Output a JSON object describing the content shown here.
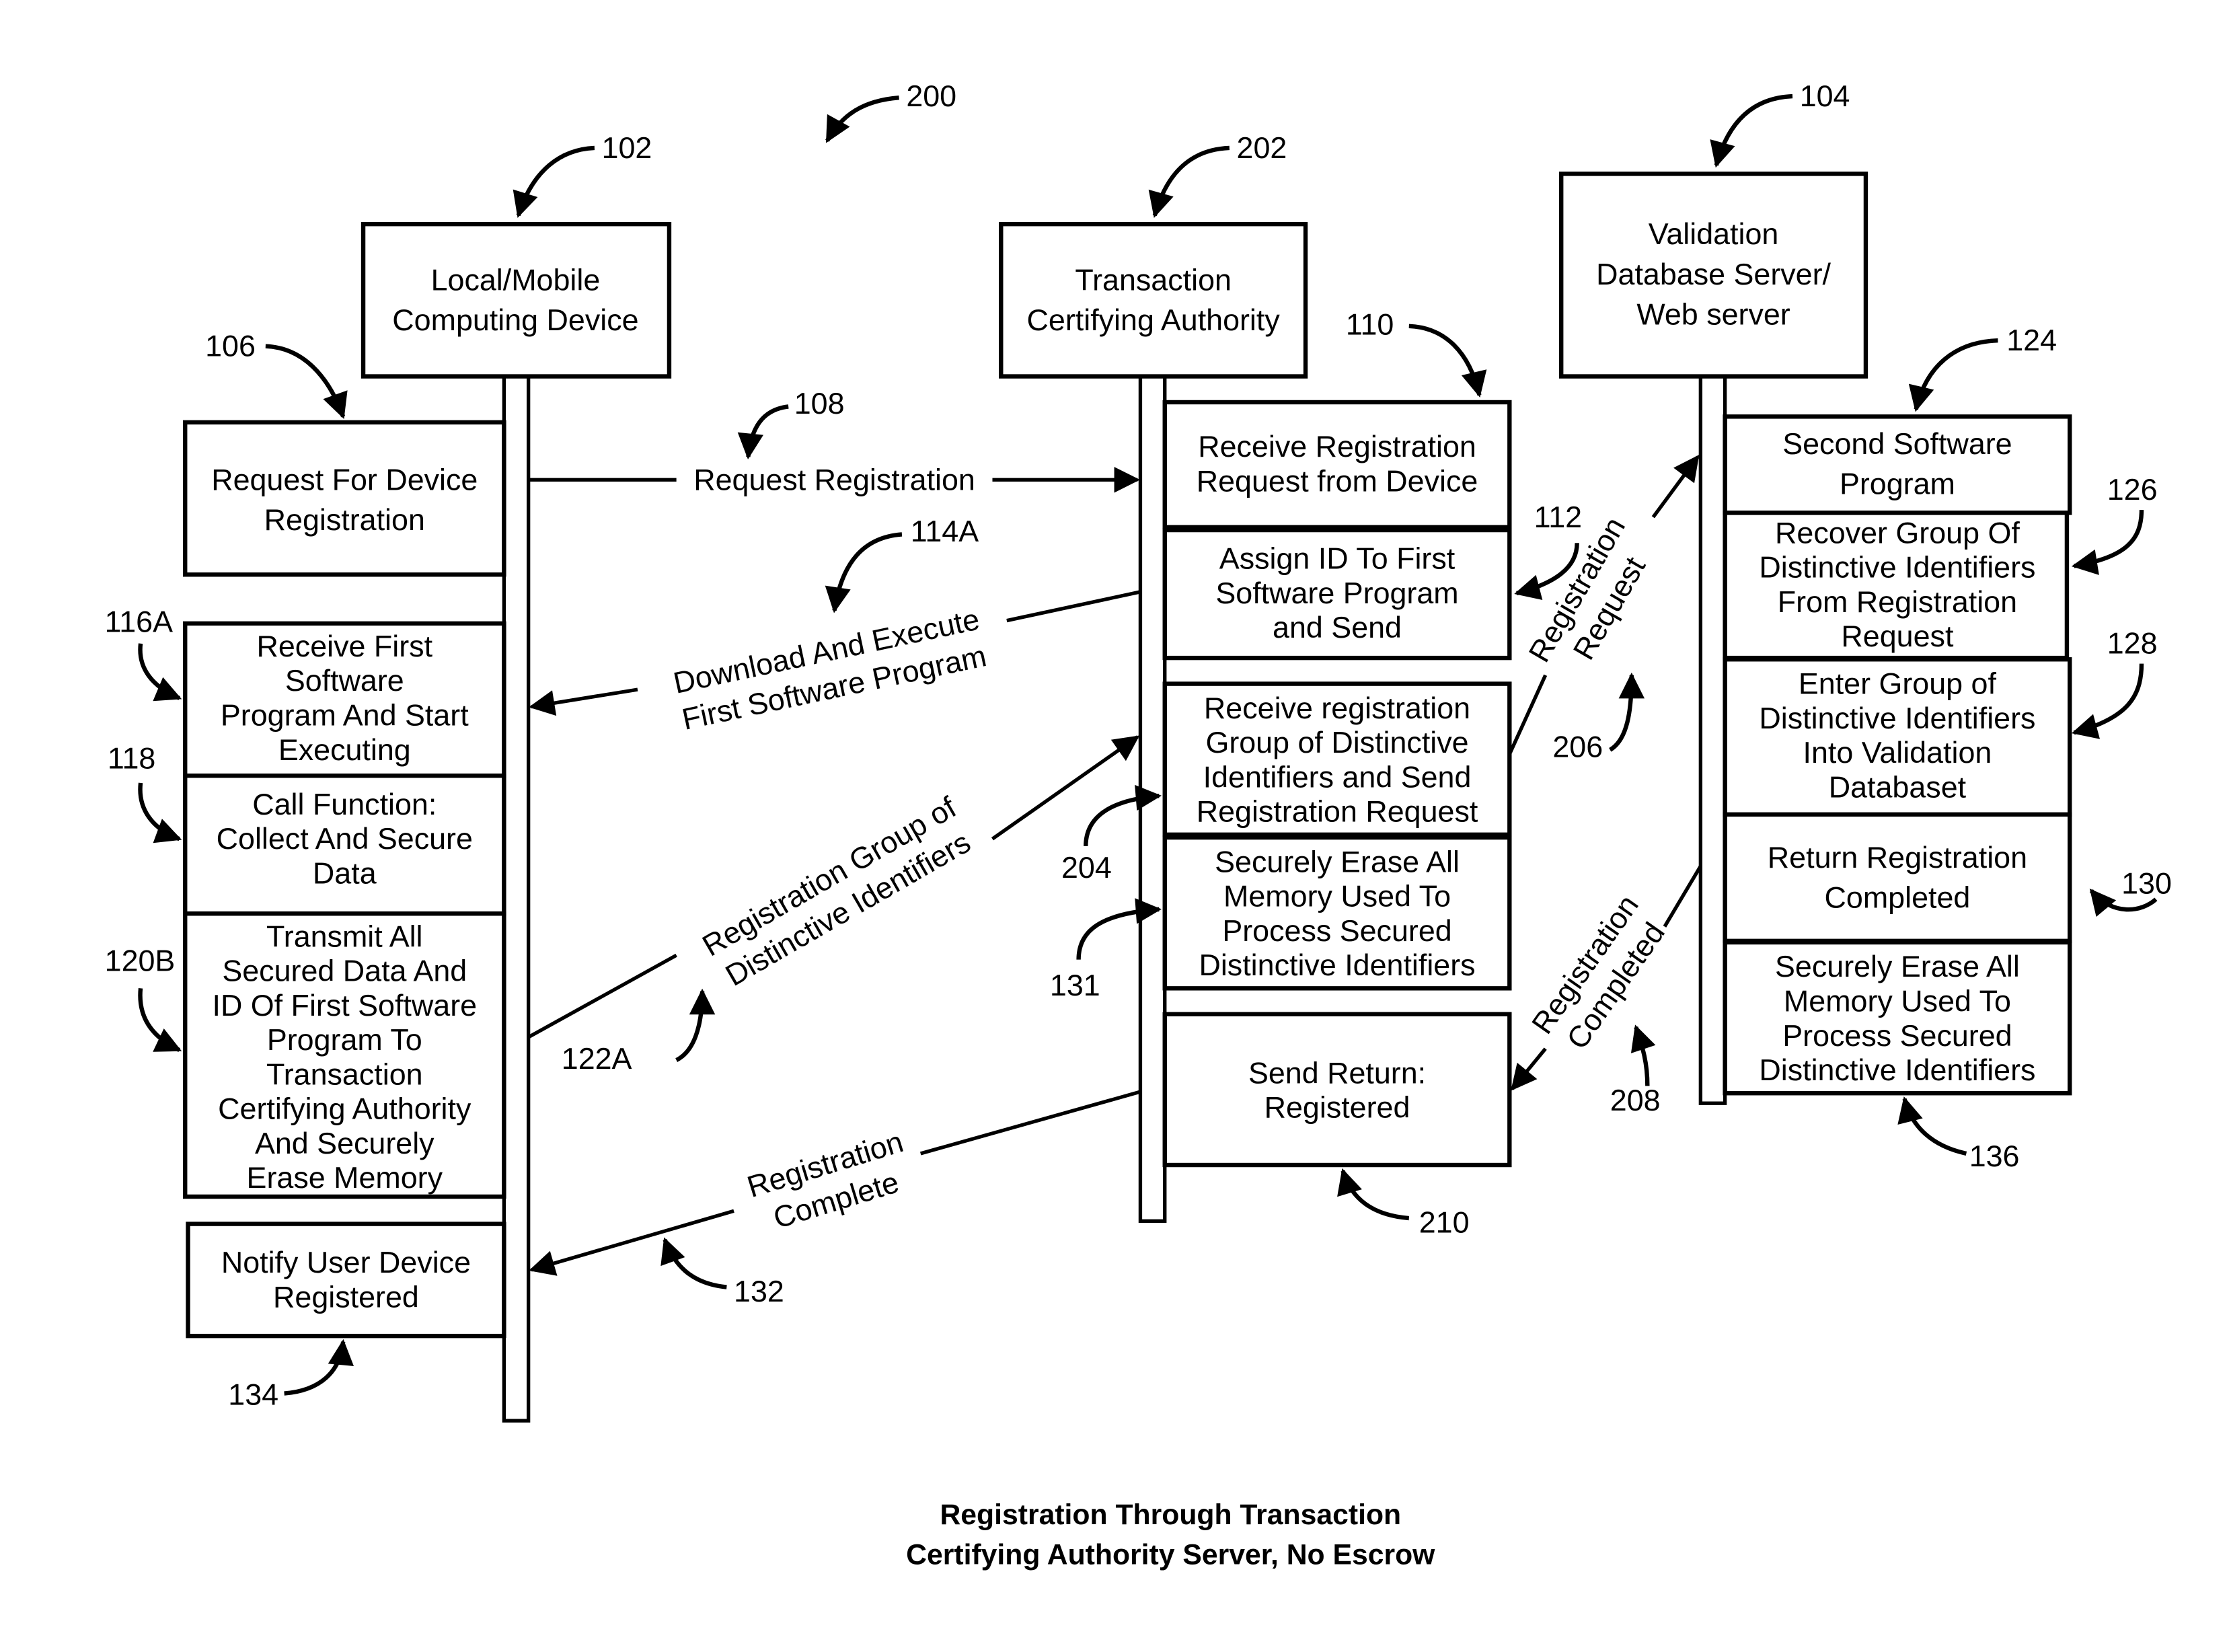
{
  "figure_ref": "200",
  "caption": [
    "Registration Through Transaction",
    "Certifying Authority Server, No Escrow"
  ],
  "actors": [
    {
      "ref": "102",
      "label": [
        "Local/Mobile",
        "Computing Device"
      ]
    },
    {
      "ref": "202",
      "label": [
        "Transaction",
        "Certifying Authority"
      ]
    },
    {
      "ref": "104",
      "label": [
        "Validation",
        "Database Server/",
        "Web server"
      ]
    }
  ],
  "device_steps": [
    {
      "ref": "106",
      "label": [
        "Request For Device",
        "Registration"
      ]
    },
    {
      "ref": "116A",
      "label": [
        "Receive First",
        "Software",
        "Program And Start",
        "Executing"
      ]
    },
    {
      "ref": "118",
      "label": [
        "Call Function:",
        "Collect And Secure",
        "Data"
      ]
    },
    {
      "ref": "120B",
      "label": [
        "Transmit All",
        "Secured Data And",
        "ID Of First Software",
        "Program To",
        "Transaction",
        "Certifying Authority",
        "And Securely",
        "Erase Memory"
      ]
    },
    {
      "ref": "134",
      "label": [
        "Notify User Device",
        "Registered"
      ]
    }
  ],
  "authority_steps": [
    {
      "ref": "110",
      "label": [
        "Receive Registration",
        "Request from Device"
      ]
    },
    {
      "ref": "112",
      "label": [
        "Assign ID To First",
        "Software Program",
        "and Send"
      ]
    },
    {
      "ref": "204",
      "label": [
        "Receive registration",
        "Group of Distinctive",
        "Identifiers and Send",
        "Registration Request"
      ]
    },
    {
      "ref": "131",
      "label": [
        "Securely Erase All",
        "Memory Used To",
        "Process Secured",
        "Distinctive Identifiers"
      ]
    },
    {
      "ref": "210",
      "label": [
        "Send Return:",
        "Registered"
      ]
    }
  ],
  "server_steps": [
    {
      "ref": "124",
      "label": [
        "Second Software",
        "Program"
      ]
    },
    {
      "ref": "126",
      "label": [
        "Recover Group Of",
        "Distinctive Identifiers",
        "From Registration",
        "Request"
      ]
    },
    {
      "ref": "128",
      "label": [
        "Enter Group of",
        "Distinctive Identifiers",
        "Into Validation",
        "Databaset"
      ]
    },
    {
      "ref": "130",
      "label": [
        "Return Registration",
        "Completed"
      ]
    },
    {
      "ref": "136",
      "label": [
        "Securely Erase All",
        "Memory Used To",
        "Process Secured",
        "Distinctive Identifiers"
      ]
    }
  ],
  "messages": [
    {
      "ref": "108",
      "label": [
        "Request Registration"
      ]
    },
    {
      "ref": "114A",
      "label": [
        "Download And Execute",
        "First  Software Program"
      ]
    },
    {
      "ref": "122A",
      "label": [
        "Registration Group of",
        "Distinctive Identifiers"
      ]
    },
    {
      "ref": "206",
      "label": [
        "Registration",
        "Request"
      ]
    },
    {
      "ref": "208",
      "label": [
        "Registration",
        "Completed"
      ]
    },
    {
      "ref": "132",
      "label": [
        "Registration",
        "Complete"
      ]
    }
  ]
}
